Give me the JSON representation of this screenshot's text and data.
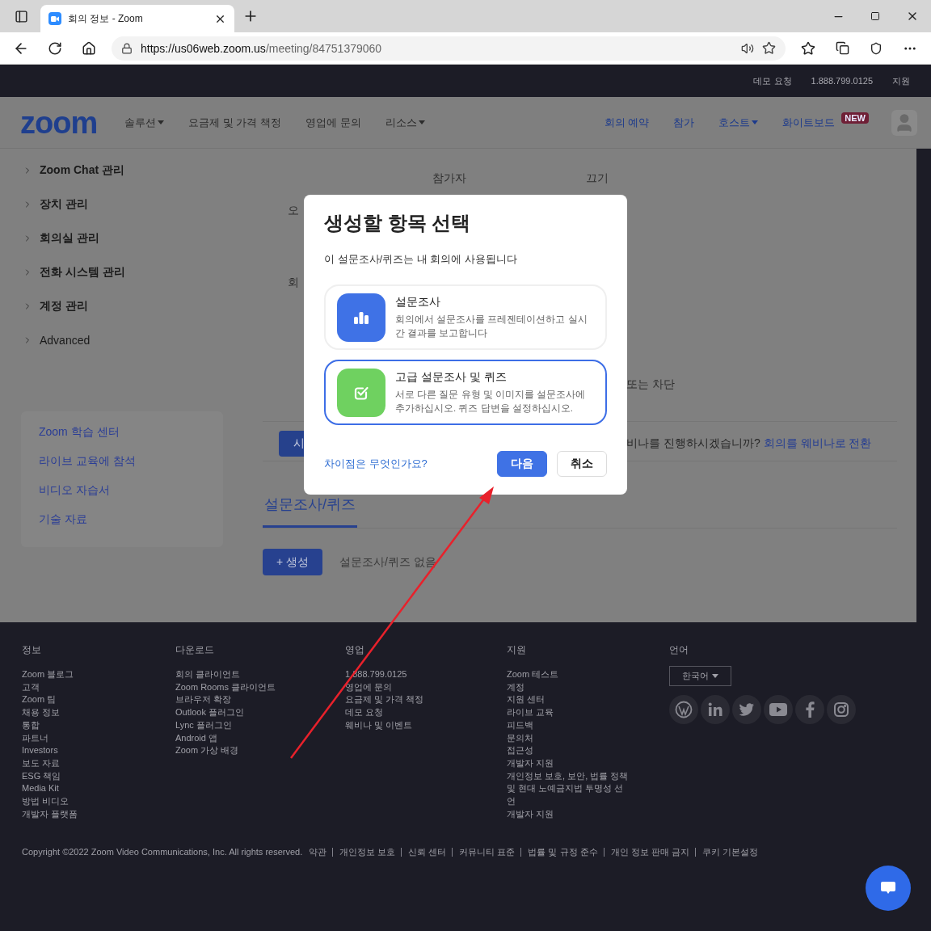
{
  "browser": {
    "tab_title": "회의 정보 - Zoom",
    "url_host": "https://us06web.zoom.us",
    "url_path": "/meeting/84751379060"
  },
  "top_bar": [
    "데모 요청",
    "1.888.799.0125",
    "지원"
  ],
  "nav": {
    "logo": "zoom",
    "left": [
      {
        "label": "솔루션",
        "dropdown": true
      },
      {
        "label": "요금제 및 가격 책정",
        "dropdown": false
      },
      {
        "label": "영업에 문의",
        "dropdown": false
      },
      {
        "label": "리소스",
        "dropdown": true
      }
    ],
    "right": [
      {
        "label": "회의 예약",
        "dropdown": false
      },
      {
        "label": "참가",
        "dropdown": false
      },
      {
        "label": "호스트",
        "dropdown": true
      },
      {
        "label": "화이트보드",
        "dropdown": false,
        "badge": "NEW"
      }
    ]
  },
  "sidebar": {
    "items": [
      "Zoom Chat 관리",
      "장치 관리",
      "회의실 관리",
      "전화 시스템 관리",
      "계정 관리",
      "Advanced"
    ],
    "links": [
      "Zoom 학습 센터",
      "라이브 교육에 참석",
      "비디오 자습서",
      "기술 자료"
    ]
  },
  "content": {
    "row_1": [
      "참가자",
      "끄기"
    ],
    "label_2": "오",
    "label_3": "회",
    "label_4": "또는 차단",
    "button_partial": "시",
    "webinar_text": "비나를 진행하시겠습니까?",
    "webinar_link": "회의를 웨비나로 전환",
    "tab": "설문조사/퀴즈",
    "create_button": "+ 생성",
    "empty_text": "설문조사/퀴즈 없음"
  },
  "modal": {
    "title": "생성할 항목 선택",
    "subtitle": "이 설문조사/퀴즈는 내 회의에 사용됩니다",
    "options": [
      {
        "title": "설문조사",
        "description": "회의에서 설문조사를 프레젠테이션하고 실시간 결과를 보고합니다",
        "color": "#3f72e6",
        "selected": false
      },
      {
        "title": "고급 설문조사 및 퀴즈",
        "description": "서로 다른 질문 유형 및 이미지를 설문조사에 추가하십시오. 퀴즈 답변을 설정하십시오.",
        "color": "#6fd160",
        "selected": true
      }
    ],
    "help_link": "차이점은 무엇인가요?",
    "buttons": [
      {
        "label": "다음",
        "kind": "primary"
      },
      {
        "label": "취소",
        "kind": "secondary"
      }
    ]
  },
  "footer": {
    "columns": [
      {
        "heading": "정보",
        "items": [
          "Zoom 블로그",
          "고객",
          "Zoom 팀",
          "채용 정보",
          "통합",
          "파트너",
          "Investors",
          "보도 자료",
          "ESG 책임",
          "Media Kit",
          "방법 비디오",
          "개발자 플랫폼"
        ]
      },
      {
        "heading": "다운로드",
        "items": [
          "회의 클라이언트",
          "Zoom Rooms 클라이언트",
          "브라우저 확장",
          "Outlook 플러그인",
          "Lync 플러그인",
          "Android 앱",
          "Zoom 가상 배경"
        ]
      },
      {
        "heading": "영업",
        "items": [
          "1.888.799.0125",
          "영업에 문의",
          "요금제 및 가격 책정",
          "데모 요청",
          "웨비나 및 이벤트"
        ]
      },
      {
        "heading": "지원",
        "items": [
          "Zoom 테스트",
          "계정",
          "지원 센터",
          "라이브 교육",
          "피드백",
          "문의처",
          "접근성",
          "개발자 지원",
          "개인정보 보호, 보안, 법률 정책 및 현대 노예금지법 투명성 선언",
          "개발자 지원"
        ]
      }
    ],
    "language": {
      "heading": "언어",
      "value": "한국어"
    },
    "copyright": "Copyright ©2022 Zoom Video Communications, Inc. All rights reserved.",
    "legal_links": [
      "약관",
      "개인정보 보호",
      "신뢰 센터",
      "커뮤니티 표준",
      "법률 및 규정 준수",
      "개인 정보 판매 금지",
      "쿠키 기본설정"
    ]
  }
}
